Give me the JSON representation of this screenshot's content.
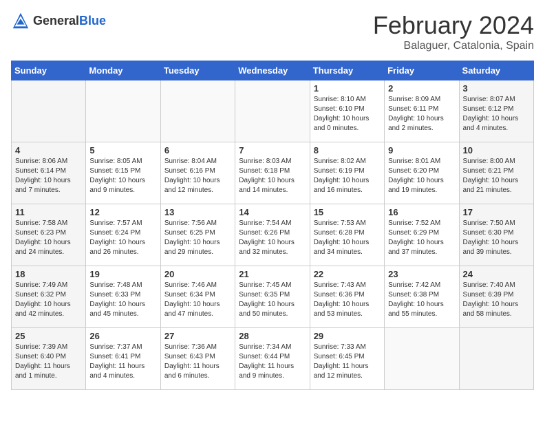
{
  "logo": {
    "general": "General",
    "blue": "Blue"
  },
  "title": "February 2024",
  "subtitle": "Balaguer, Catalonia, Spain",
  "weekdays": [
    "Sunday",
    "Monday",
    "Tuesday",
    "Wednesday",
    "Thursday",
    "Friday",
    "Saturday"
  ],
  "weeks": [
    [
      {
        "day": "",
        "info": ""
      },
      {
        "day": "",
        "info": ""
      },
      {
        "day": "",
        "info": ""
      },
      {
        "day": "",
        "info": ""
      },
      {
        "day": "1",
        "info": "Sunrise: 8:10 AM\nSunset: 6:10 PM\nDaylight: 10 hours\nand 0 minutes."
      },
      {
        "day": "2",
        "info": "Sunrise: 8:09 AM\nSunset: 6:11 PM\nDaylight: 10 hours\nand 2 minutes."
      },
      {
        "day": "3",
        "info": "Sunrise: 8:07 AM\nSunset: 6:12 PM\nDaylight: 10 hours\nand 4 minutes."
      }
    ],
    [
      {
        "day": "4",
        "info": "Sunrise: 8:06 AM\nSunset: 6:14 PM\nDaylight: 10 hours\nand 7 minutes."
      },
      {
        "day": "5",
        "info": "Sunrise: 8:05 AM\nSunset: 6:15 PM\nDaylight: 10 hours\nand 9 minutes."
      },
      {
        "day": "6",
        "info": "Sunrise: 8:04 AM\nSunset: 6:16 PM\nDaylight: 10 hours\nand 12 minutes."
      },
      {
        "day": "7",
        "info": "Sunrise: 8:03 AM\nSunset: 6:18 PM\nDaylight: 10 hours\nand 14 minutes."
      },
      {
        "day": "8",
        "info": "Sunrise: 8:02 AM\nSunset: 6:19 PM\nDaylight: 10 hours\nand 16 minutes."
      },
      {
        "day": "9",
        "info": "Sunrise: 8:01 AM\nSunset: 6:20 PM\nDaylight: 10 hours\nand 19 minutes."
      },
      {
        "day": "10",
        "info": "Sunrise: 8:00 AM\nSunset: 6:21 PM\nDaylight: 10 hours\nand 21 minutes."
      }
    ],
    [
      {
        "day": "11",
        "info": "Sunrise: 7:58 AM\nSunset: 6:23 PM\nDaylight: 10 hours\nand 24 minutes."
      },
      {
        "day": "12",
        "info": "Sunrise: 7:57 AM\nSunset: 6:24 PM\nDaylight: 10 hours\nand 26 minutes."
      },
      {
        "day": "13",
        "info": "Sunrise: 7:56 AM\nSunset: 6:25 PM\nDaylight: 10 hours\nand 29 minutes."
      },
      {
        "day": "14",
        "info": "Sunrise: 7:54 AM\nSunset: 6:26 PM\nDaylight: 10 hours\nand 32 minutes."
      },
      {
        "day": "15",
        "info": "Sunrise: 7:53 AM\nSunset: 6:28 PM\nDaylight: 10 hours\nand 34 minutes."
      },
      {
        "day": "16",
        "info": "Sunrise: 7:52 AM\nSunset: 6:29 PM\nDaylight: 10 hours\nand 37 minutes."
      },
      {
        "day": "17",
        "info": "Sunrise: 7:50 AM\nSunset: 6:30 PM\nDaylight: 10 hours\nand 39 minutes."
      }
    ],
    [
      {
        "day": "18",
        "info": "Sunrise: 7:49 AM\nSunset: 6:32 PM\nDaylight: 10 hours\nand 42 minutes."
      },
      {
        "day": "19",
        "info": "Sunrise: 7:48 AM\nSunset: 6:33 PM\nDaylight: 10 hours\nand 45 minutes."
      },
      {
        "day": "20",
        "info": "Sunrise: 7:46 AM\nSunset: 6:34 PM\nDaylight: 10 hours\nand 47 minutes."
      },
      {
        "day": "21",
        "info": "Sunrise: 7:45 AM\nSunset: 6:35 PM\nDaylight: 10 hours\nand 50 minutes."
      },
      {
        "day": "22",
        "info": "Sunrise: 7:43 AM\nSunset: 6:36 PM\nDaylight: 10 hours\nand 53 minutes."
      },
      {
        "day": "23",
        "info": "Sunrise: 7:42 AM\nSunset: 6:38 PM\nDaylight: 10 hours\nand 55 minutes."
      },
      {
        "day": "24",
        "info": "Sunrise: 7:40 AM\nSunset: 6:39 PM\nDaylight: 10 hours\nand 58 minutes."
      }
    ],
    [
      {
        "day": "25",
        "info": "Sunrise: 7:39 AM\nSunset: 6:40 PM\nDaylight: 11 hours\nand 1 minute."
      },
      {
        "day": "26",
        "info": "Sunrise: 7:37 AM\nSunset: 6:41 PM\nDaylight: 11 hours\nand 4 minutes."
      },
      {
        "day": "27",
        "info": "Sunrise: 7:36 AM\nSunset: 6:43 PM\nDaylight: 11 hours\nand 6 minutes."
      },
      {
        "day": "28",
        "info": "Sunrise: 7:34 AM\nSunset: 6:44 PM\nDaylight: 11 hours\nand 9 minutes."
      },
      {
        "day": "29",
        "info": "Sunrise: 7:33 AM\nSunset: 6:45 PM\nDaylight: 11 hours\nand 12 minutes."
      },
      {
        "day": "",
        "info": ""
      },
      {
        "day": "",
        "info": ""
      }
    ]
  ]
}
